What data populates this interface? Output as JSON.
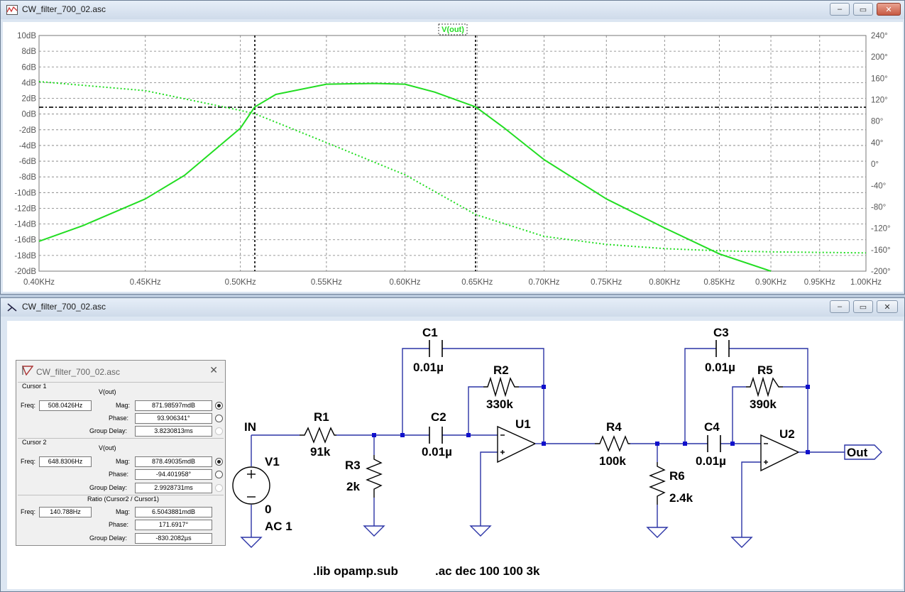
{
  "plot_window": {
    "title": "CW_filter_700_02.asc",
    "trace_label": "V(out)",
    "colors": {
      "trace": "#22dd22",
      "grid": "#7a7a7a",
      "cursor": "#000000"
    }
  },
  "schematic_window": {
    "title": "CW_filter_700_02.asc"
  },
  "chart_data": {
    "type": "line",
    "title": "",
    "xlabel": "",
    "ylabel": "",
    "x_ticks": [
      "0.40KHz",
      "0.45KHz",
      "0.50KHz",
      "0.55KHz",
      "0.60KHz",
      "0.65KHz",
      "0.70KHz",
      "0.75KHz",
      "0.80KHz",
      "0.85KHz",
      "0.90KHz",
      "0.95KHz",
      "1.00KHz"
    ],
    "y_left_ticks": [
      "10dB",
      "8dB",
      "6dB",
      "4dB",
      "2dB",
      "0dB",
      "-2dB",
      "-4dB",
      "-6dB",
      "-8dB",
      "-10dB",
      "-12dB",
      "-14dB",
      "-16dB",
      "-18dB",
      "-20dB"
    ],
    "y_right_ticks": [
      "240°",
      "200°",
      "160°",
      "120°",
      "80°",
      "40°",
      "0°",
      "-40°",
      "-80°",
      "-120°",
      "-160°",
      "-200°"
    ],
    "xlim_khz": [
      0.4,
      1.0
    ],
    "x_scale": "log",
    "ylim_db": [
      -20,
      10
    ],
    "ylim_deg": [
      -200,
      240
    ],
    "grid": true,
    "series": [
      {
        "name": "V(out)",
        "unit": "dB",
        "line": "solid",
        "x_khz": [
          0.4,
          0.42,
          0.45,
          0.47,
          0.5,
          0.508,
          0.52,
          0.55,
          0.58,
          0.6,
          0.62,
          0.649,
          0.67,
          0.7,
          0.75,
          0.8,
          0.85,
          0.9
        ],
        "values": [
          -16.2,
          -14.2,
          -10.8,
          -7.8,
          -1.8,
          0.9,
          2.5,
          3.8,
          3.9,
          3.8,
          2.8,
          0.9,
          -1.8,
          -5.8,
          -10.8,
          -14.5,
          -17.8,
          -20.0
        ]
      },
      {
        "name": "V(out)",
        "unit": "deg",
        "line": "dotted",
        "x_khz": [
          0.4,
          0.45,
          0.5,
          0.508,
          0.55,
          0.6,
          0.649,
          0.7,
          0.75,
          0.8,
          0.85,
          0.9,
          1.0
        ],
        "values": [
          154,
          137,
          100,
          93.9,
          40,
          -20,
          -94.4,
          -135,
          -150,
          -158,
          -162,
          -164,
          -166
        ]
      }
    ],
    "cursors_khz": [
      0.5080426,
      0.6488306
    ],
    "cursor_level_db": 0.87
  },
  "cursor_dialog": {
    "title": "CW_filter_700_02.asc",
    "cursor1": {
      "header": "Cursor 1",
      "trace": "V(out)",
      "freq_label": "Freq:",
      "freq": "508.0426Hz",
      "mag_label": "Mag:",
      "mag": "871.98597mdB",
      "phase_label": "Phase:",
      "phase": "93.906341°",
      "gd_label": "Group Delay:",
      "gd": "3.8230813ms"
    },
    "cursor2": {
      "header": "Cursor 2",
      "trace": "V(out)",
      "freq_label": "Freq:",
      "freq": "648.8306Hz",
      "mag_label": "Mag:",
      "mag": "878.49035mdB",
      "phase_label": "Phase:",
      "phase": "-94.401958°",
      "gd_label": "Group Delay:",
      "gd": "2.9928731ms"
    },
    "ratio": {
      "header": "Ratio (Cursor2 / Cursor1)",
      "freq_label": "Freq:",
      "freq": "140.788Hz",
      "mag_label": "Mag:",
      "mag": "6.5043881mdB",
      "phase_label": "Phase:",
      "phase": "171.6917°",
      "gd_label": "Group Delay:",
      "gd": "-830.2082µs"
    }
  },
  "schematic": {
    "labels": {
      "in": "IN",
      "v1": "V1",
      "v1_val1": "0",
      "v1_val2": "AC 1",
      "r1": "R1",
      "r1_val": "91k",
      "r3": "R3",
      "r3_val": "2k",
      "c1": "C1",
      "c1_val": "0.01µ",
      "c2": "C2",
      "c2_val": "0.01µ",
      "r2": "R2",
      "r2_val": "330k",
      "u1": "U1",
      "r4": "R4",
      "r4_val": "100k",
      "r6": "R6",
      "r6_val": "2.4k",
      "c3": "C3",
      "c3_val": "0.01µ",
      "c4": "C4",
      "c4_val": "0.01µ",
      "r5": "R5",
      "r5_val": "390k",
      "u2": "U2",
      "out": "Out"
    },
    "directives": {
      "lib": ".lib opamp.sub",
      "ac": ".ac dec 100 100 3k"
    },
    "colors": {
      "wire": "#2a33a6",
      "node": "#1010cc"
    }
  }
}
